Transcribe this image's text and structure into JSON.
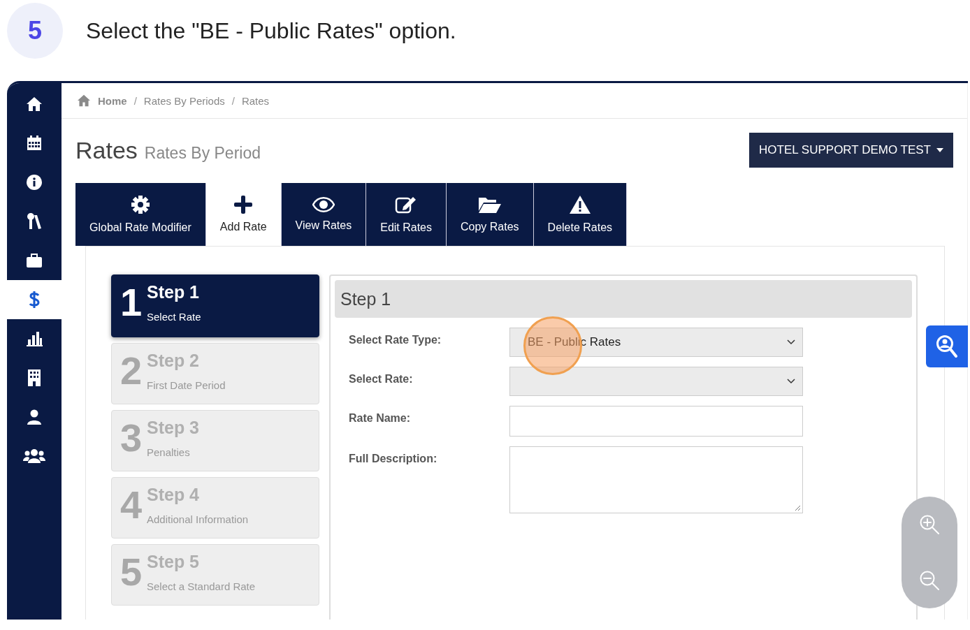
{
  "tutorial": {
    "step_number": "5",
    "instruction": "Select the \"BE - Public Rates\" option."
  },
  "sidebar": {
    "items": [
      {
        "kind": "home",
        "selected": false
      },
      {
        "kind": "calendar",
        "selected": false
      },
      {
        "kind": "info",
        "selected": false
      },
      {
        "kind": "keys",
        "selected": false
      },
      {
        "kind": "briefcase",
        "selected": false
      },
      {
        "kind": "dollar",
        "selected": true
      },
      {
        "kind": "chart",
        "selected": false
      },
      {
        "kind": "building",
        "selected": false
      },
      {
        "kind": "user",
        "selected": false
      },
      {
        "kind": "users",
        "selected": false
      }
    ]
  },
  "breadcrumb": {
    "separator": "/",
    "items": [
      "Home",
      "Rates By Periods",
      "Rates"
    ]
  },
  "page": {
    "title": "Rates",
    "subtitle": "Rates By Period",
    "hotel_menu": "HOTEL SUPPORT DEMO TEST"
  },
  "toolbar": [
    {
      "label": "Global Rate Modifier",
      "selected": false
    },
    {
      "label": "Add Rate",
      "selected": true
    },
    {
      "label": "View Rates",
      "selected": false
    },
    {
      "label": "Edit Rates",
      "selected": false
    },
    {
      "label": "Copy Rates",
      "selected": false
    },
    {
      "label": "Delete Rates",
      "selected": false
    }
  ],
  "steps": [
    {
      "number": "1",
      "title": "Step 1",
      "subtitle": "Select Rate",
      "selected": true
    },
    {
      "number": "2",
      "title": "Step 2",
      "subtitle": "First Date Period",
      "selected": false
    },
    {
      "number": "3",
      "title": "Step 3",
      "subtitle": "Penalties",
      "selected": false
    },
    {
      "number": "4",
      "title": "Step 4",
      "subtitle": "Additional Information",
      "selected": false
    },
    {
      "number": "5",
      "title": "Step 5",
      "subtitle": "Select a Standard Rate",
      "selected": false
    }
  ],
  "form": {
    "heading": "Step 1",
    "fields": [
      {
        "label": "Select Rate Type:",
        "kind": "select",
        "value": "BE - Public Rates",
        "highlighted": true
      },
      {
        "label": "Select Rate:",
        "kind": "select",
        "highlighted": false
      },
      {
        "label": "Rate Name:",
        "kind": "input",
        "highlighted": false
      },
      {
        "label": "Full Description:",
        "kind": "textarea",
        "highlighted": false
      }
    ]
  }
}
